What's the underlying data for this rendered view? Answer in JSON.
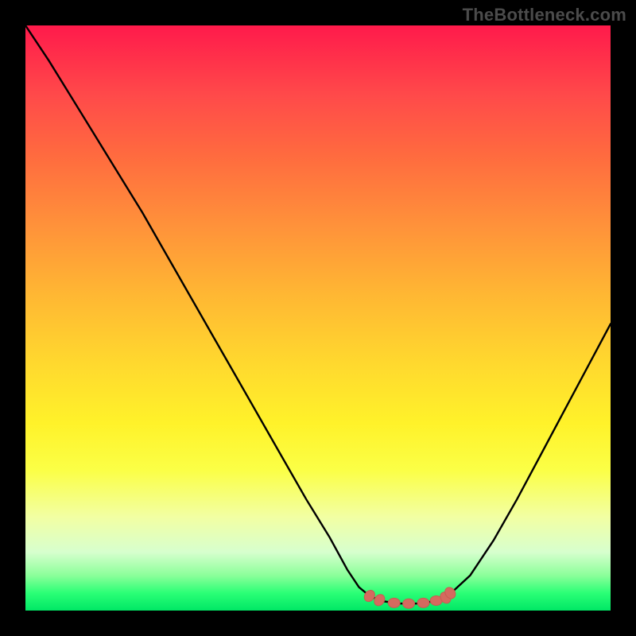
{
  "watermark": {
    "text": "TheBottleneck.com"
  },
  "colors": {
    "curve_stroke": "#000000",
    "marker_fill": "#d46a5f",
    "marker_stroke": "#c95b50"
  },
  "chart_data": {
    "type": "line",
    "title": "",
    "xlabel": "",
    "ylabel": "",
    "xlim": [
      0,
      100
    ],
    "ylim": [
      0,
      100
    ],
    "grid": false,
    "series": [
      {
        "name": "left-curve",
        "x": [
          0,
          4,
          8,
          12,
          16,
          20,
          24,
          28,
          32,
          36,
          40,
          44,
          48,
          52,
          55,
          57,
          58.8
        ],
        "y": [
          100,
          94,
          87.5,
          81,
          74.5,
          68,
          61,
          54,
          47,
          40,
          33,
          26,
          19,
          12.5,
          7,
          4,
          2.5
        ]
      },
      {
        "name": "floor",
        "x": [
          58.8,
          61,
          64,
          67,
          70,
          72.2
        ],
        "y": [
          2.5,
          1.6,
          1.2,
          1.2,
          1.6,
          2.5
        ]
      },
      {
        "name": "right-curve",
        "x": [
          72.2,
          76,
          80,
          84,
          88,
          92,
          96,
          100
        ],
        "y": [
          2.5,
          6,
          12,
          19,
          26.5,
          34,
          41.5,
          49
        ]
      }
    ],
    "markers": {
      "name": "ideal-zone-markers",
      "shape": "ellipse",
      "x": [
        58.8,
        60.5,
        63,
        65.5,
        68,
        70.2,
        71.8,
        72.6
      ],
      "y": [
        2.5,
        1.8,
        1.3,
        1.2,
        1.3,
        1.7,
        2.2,
        3.0
      ]
    }
  }
}
